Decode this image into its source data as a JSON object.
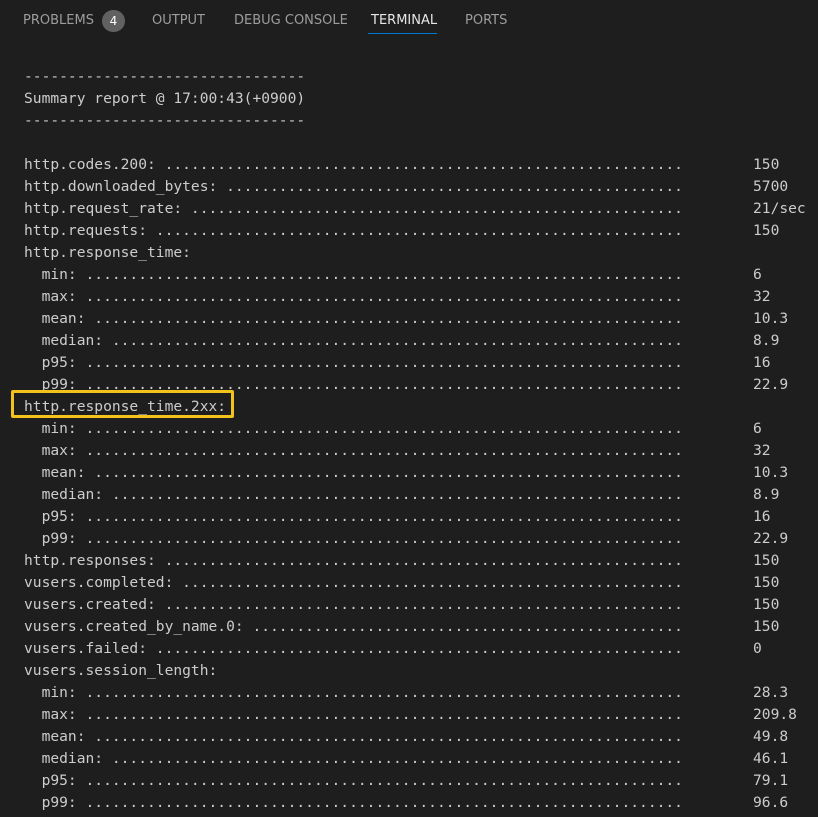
{
  "tabs": {
    "problems": "PROBLEMS",
    "problems_count": "4",
    "output": "OUTPUT",
    "debug_console": "DEBUG CONSOLE",
    "terminal": "TERMINAL",
    "ports": "PORTS"
  },
  "colors": {
    "background": "#1e1e1e",
    "text": "#cccccc",
    "active_tab_underline": "#0078d4",
    "highlight_box": "#f2c31a"
  },
  "terminal": {
    "separator_top": "--------------------------------",
    "report_title": "Summary report @ 17:00:43(+0900)",
    "separator_bottom": "--------------------------------",
    "metrics": [
      {
        "label": "http.codes.200: ........................................................... ",
        "value": "150"
      },
      {
        "label": "http.downloaded_bytes: .................................................... ",
        "value": "5700"
      },
      {
        "label": "http.request_rate: ........................................................ ",
        "value": "21/sec"
      },
      {
        "label": "http.requests: ............................................................ ",
        "value": "150"
      },
      {
        "label": "http.response_time:",
        "value": ""
      },
      {
        "label": "  min: .................................................................... ",
        "value": "6"
      },
      {
        "label": "  max: .................................................................... ",
        "value": "32"
      },
      {
        "label": "  mean: ................................................................... ",
        "value": "10.3"
      },
      {
        "label": "  median: ................................................................. ",
        "value": "8.9"
      },
      {
        "label": "  p95: .................................................................... ",
        "value": "16"
      },
      {
        "label": "  p99: .................................................................... ",
        "value": "22.9"
      },
      {
        "label": "http.response_time.2xx:",
        "value": ""
      },
      {
        "label": "  min: .................................................................... ",
        "value": "6"
      },
      {
        "label": "  max: .................................................................... ",
        "value": "32"
      },
      {
        "label": "  mean: ................................................................... ",
        "value": "10.3"
      },
      {
        "label": "  median: ................................................................. ",
        "value": "8.9"
      },
      {
        "label": "  p95: .................................................................... ",
        "value": "16"
      },
      {
        "label": "  p99: .................................................................... ",
        "value": "22.9"
      },
      {
        "label": "http.responses: ........................................................... ",
        "value": "150"
      },
      {
        "label": "vusers.completed: ......................................................... ",
        "value": "150"
      },
      {
        "label": "vusers.created: ........................................................... ",
        "value": "150"
      },
      {
        "label": "vusers.created_by_name.0: ................................................. ",
        "value": "150"
      },
      {
        "label": "vusers.failed: ............................................................ ",
        "value": "0"
      },
      {
        "label": "vusers.session_length:",
        "value": ""
      },
      {
        "label": "  min: .................................................................... ",
        "value": "28.3"
      },
      {
        "label": "  max: .................................................................... ",
        "value": "209.8"
      },
      {
        "label": "  mean: ................................................................... ",
        "value": "49.8"
      },
      {
        "label": "  median: ................................................................. ",
        "value": "46.1"
      },
      {
        "label": "  p95: .................................................................... ",
        "value": "79.1"
      },
      {
        "label": "  p99: .................................................................... ",
        "value": "96.6"
      }
    ]
  }
}
